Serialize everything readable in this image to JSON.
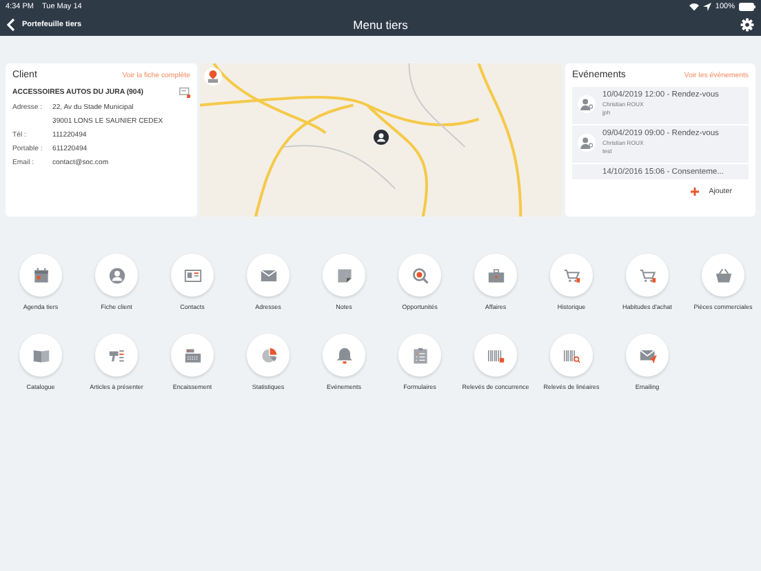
{
  "status_bar": {
    "time": "4:34 PM",
    "date": "Tue May 14",
    "battery": "100%"
  },
  "nav": {
    "back_label": "Portefeuille tiers",
    "title": "Menu tiers"
  },
  "client": {
    "title": "Client",
    "link": "Voir la fiche complète",
    "name": "ACCESSOIRES AUTOS DU JURA (904)",
    "fields": [
      {
        "label": "Adresse :",
        "lines": [
          "22, Av du Stade Municipal",
          "39001 LONS LE SAUNIER CEDEX"
        ]
      },
      {
        "label": "Tél :",
        "lines": [
          "111220494"
        ]
      },
      {
        "label": "Portable :",
        "lines": [
          "611220494"
        ]
      },
      {
        "label": "Email :",
        "lines": [
          "contact@soc.com"
        ]
      }
    ]
  },
  "events": {
    "title": "Evénements",
    "link": "Voir les événements",
    "add": "Ajouter",
    "items": [
      {
        "title": "10/04/2019 12:00 - Rendez-vous",
        "person": "Christian ROUX",
        "note": "jph"
      },
      {
        "title": "09/04/2019 09:00 - Rendez-vous",
        "person": "Christian ROUX",
        "note": "test"
      },
      {
        "title": "14/10/2016 15:06 - Consenteme..."
      }
    ]
  },
  "menu": [
    {
      "kind": "calendar",
      "label": "Agenda tiers"
    },
    {
      "kind": "person",
      "label": "Fiche client"
    },
    {
      "kind": "card",
      "label": "Contacts"
    },
    {
      "kind": "envelope",
      "label": "Adresses"
    },
    {
      "kind": "note",
      "label": "Notes"
    },
    {
      "kind": "search",
      "label": "Opportunités"
    },
    {
      "kind": "briefcase",
      "label": "Affaires"
    },
    {
      "kind": "cart",
      "label": "Historique"
    },
    {
      "kind": "cart",
      "label": "Habitudes d'achat"
    },
    {
      "kind": "basket",
      "label": "Pièces commerciales"
    },
    {
      "kind": "book",
      "label": "Catalogue"
    },
    {
      "kind": "gun",
      "label": "Articles à présenter"
    },
    {
      "kind": "register",
      "label": "Encaissement"
    },
    {
      "kind": "pie",
      "label": "Statistiques"
    },
    {
      "kind": "bell",
      "label": "Evénements"
    },
    {
      "kind": "clipboard",
      "label": "Formulaires"
    },
    {
      "kind": "barcode",
      "label": "Relevés de concurrence"
    },
    {
      "kind": "barcode-search",
      "label": "Relevés de linéaires"
    },
    {
      "kind": "mail-send",
      "label": "Emailing"
    }
  ]
}
